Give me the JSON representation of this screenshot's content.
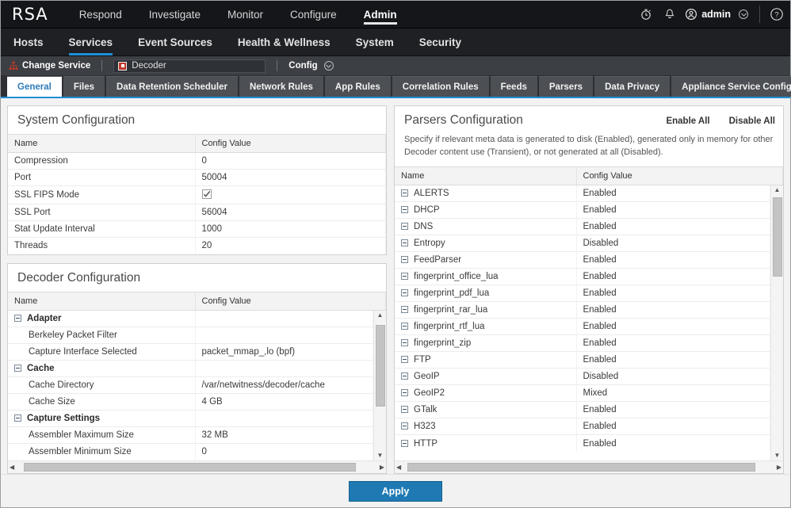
{
  "brand": {
    "logo": "RSA",
    "accent": "#1f8fd6"
  },
  "topnav": {
    "items": [
      {
        "label": "Respond",
        "active": false
      },
      {
        "label": "Investigate",
        "active": false
      },
      {
        "label": "Monitor",
        "active": false
      },
      {
        "label": "Configure",
        "active": false
      },
      {
        "label": "Admin",
        "active": true
      }
    ],
    "user": "admin"
  },
  "subnav": {
    "items": [
      {
        "label": "Hosts",
        "active": false
      },
      {
        "label": "Services",
        "active": true
      },
      {
        "label": "Event Sources",
        "active": false
      },
      {
        "label": "Health & Wellness",
        "active": false
      },
      {
        "label": "System",
        "active": false
      },
      {
        "label": "Security",
        "active": false
      }
    ]
  },
  "servicebar": {
    "change_service": "Change Service",
    "service_name": "Decoder",
    "config_label": "Config"
  },
  "tabs": [
    {
      "label": "General",
      "active": true
    },
    {
      "label": "Files",
      "active": false
    },
    {
      "label": "Data Retention Scheduler",
      "active": false
    },
    {
      "label": "Network Rules",
      "active": false
    },
    {
      "label": "App Rules",
      "active": false
    },
    {
      "label": "Correlation Rules",
      "active": false
    },
    {
      "label": "Feeds",
      "active": false
    },
    {
      "label": "Parsers",
      "active": false
    },
    {
      "label": "Data Privacy",
      "active": false
    },
    {
      "label": "Appliance Service Configuration",
      "active": false
    }
  ],
  "system_config": {
    "title": "System Configuration",
    "columns": [
      "Name",
      "Config Value"
    ],
    "rows": [
      {
        "name": "Compression",
        "value": "0",
        "type": "text"
      },
      {
        "name": "Port",
        "value": "50004",
        "type": "text"
      },
      {
        "name": "SSL FIPS Mode",
        "value": "",
        "type": "checkbox",
        "checked": true
      },
      {
        "name": "SSL Port",
        "value": "56004",
        "type": "text"
      },
      {
        "name": "Stat Update Interval",
        "value": "1000",
        "type": "text"
      },
      {
        "name": "Threads",
        "value": "20",
        "type": "text"
      }
    ]
  },
  "decoder_config": {
    "title": "Decoder Configuration",
    "columns": [
      "Name",
      "Config Value"
    ],
    "rows": [
      {
        "name": "Adapter",
        "value": "",
        "group": true
      },
      {
        "name": "Berkeley Packet Filter",
        "value": "",
        "group": false
      },
      {
        "name": "Capture Interface Selected",
        "value": "packet_mmap_,lo (bpf)",
        "group": false
      },
      {
        "name": "Cache",
        "value": "",
        "group": true
      },
      {
        "name": "Cache Directory",
        "value": "/var/netwitness/decoder/cache",
        "group": false
      },
      {
        "name": "Cache Size",
        "value": "4 GB",
        "group": false
      },
      {
        "name": "Capture Settings",
        "value": "",
        "group": true
      },
      {
        "name": "Assembler Maximum Size",
        "value": "32 MB",
        "group": false
      },
      {
        "name": "Assembler Minimum Size",
        "value": "0",
        "group": false
      }
    ]
  },
  "parsers_config": {
    "title": "Parsers Configuration",
    "enable_all": "Enable All",
    "disable_all": "Disable All",
    "description": "Specify if relevant meta data is generated to disk (Enabled), generated only in memory for other Decoder content use (Transient), or not generated at all (Disabled).",
    "columns": [
      "Name",
      "Config Value"
    ],
    "rows": [
      {
        "name": "ALERTS",
        "value": "Enabled"
      },
      {
        "name": "DHCP",
        "value": "Enabled"
      },
      {
        "name": "DNS",
        "value": "Enabled"
      },
      {
        "name": "Entropy",
        "value": "Disabled"
      },
      {
        "name": "FeedParser",
        "value": "Enabled"
      },
      {
        "name": "fingerprint_office_lua",
        "value": "Enabled"
      },
      {
        "name": "fingerprint_pdf_lua",
        "value": "Enabled"
      },
      {
        "name": "fingerprint_rar_lua",
        "value": "Enabled"
      },
      {
        "name": "fingerprint_rtf_lua",
        "value": "Enabled"
      },
      {
        "name": "fingerprint_zip",
        "value": "Enabled"
      },
      {
        "name": "FTP",
        "value": "Enabled"
      },
      {
        "name": "GeoIP",
        "value": "Disabled"
      },
      {
        "name": "GeoIP2",
        "value": "Mixed"
      },
      {
        "name": "GTalk",
        "value": "Enabled"
      },
      {
        "name": "H323",
        "value": "Enabled"
      },
      {
        "name": "HTTP",
        "value": "Enabled"
      }
    ]
  },
  "footer": {
    "apply": "Apply"
  }
}
